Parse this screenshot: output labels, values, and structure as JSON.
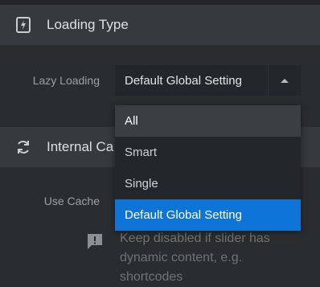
{
  "loading_section": {
    "title": "Loading Type",
    "icon": "lazy-loading-icon"
  },
  "lazy_loading": {
    "label": "Lazy Loading",
    "selected_value": "Default Global Setting",
    "options": [
      "All",
      "Smart",
      "Single",
      "Default Global Setting"
    ]
  },
  "internal_section": {
    "title": "Internal Ca",
    "icon": "refresh-icon"
  },
  "use_cache": {
    "label": "Use Cache"
  },
  "hint": {
    "icon": "comment-alert-icon",
    "text": "Keep disabled if slider has dynamic content, e.g. shortcodes"
  },
  "colors": {
    "accent": "#0f74d8",
    "header_bg": "#353a3f",
    "page_bg": "#2a2d30"
  }
}
